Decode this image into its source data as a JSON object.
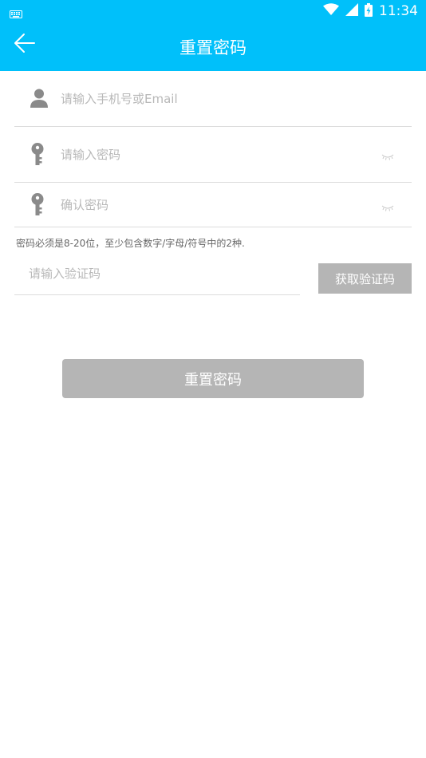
{
  "status_bar": {
    "time": "11:34",
    "icons": [
      "keyboard-icon",
      "wifi-icon",
      "cell-signal-icon",
      "battery-charging-icon"
    ]
  },
  "app_bar": {
    "title": "重置密码",
    "back_icon": "back-arrow-icon"
  },
  "form": {
    "account": {
      "placeholder": "请输入手机号或Email",
      "value": "",
      "icon": "person-icon"
    },
    "password": {
      "placeholder": "请输入密码",
      "value": "",
      "icon": "key-icon",
      "toggle_icon": "closed-eye-icon"
    },
    "confirm_password": {
      "placeholder": "确认密码",
      "value": "",
      "icon": "key-icon",
      "toggle_icon": "closed-eye-icon"
    },
    "password_hint": "密码必须是8-20位，至少包含数字/字母/符号中的2种.",
    "verification_code": {
      "placeholder": "请输入验证码",
      "value": ""
    },
    "get_code_label": "获取验证码",
    "submit_label": "重置密码"
  },
  "colors": {
    "primary": "#00c0fa",
    "disabled_button": "#b5b5b5",
    "icon_gray": "#8a8a8a",
    "divider": "#dcdcdc"
  }
}
